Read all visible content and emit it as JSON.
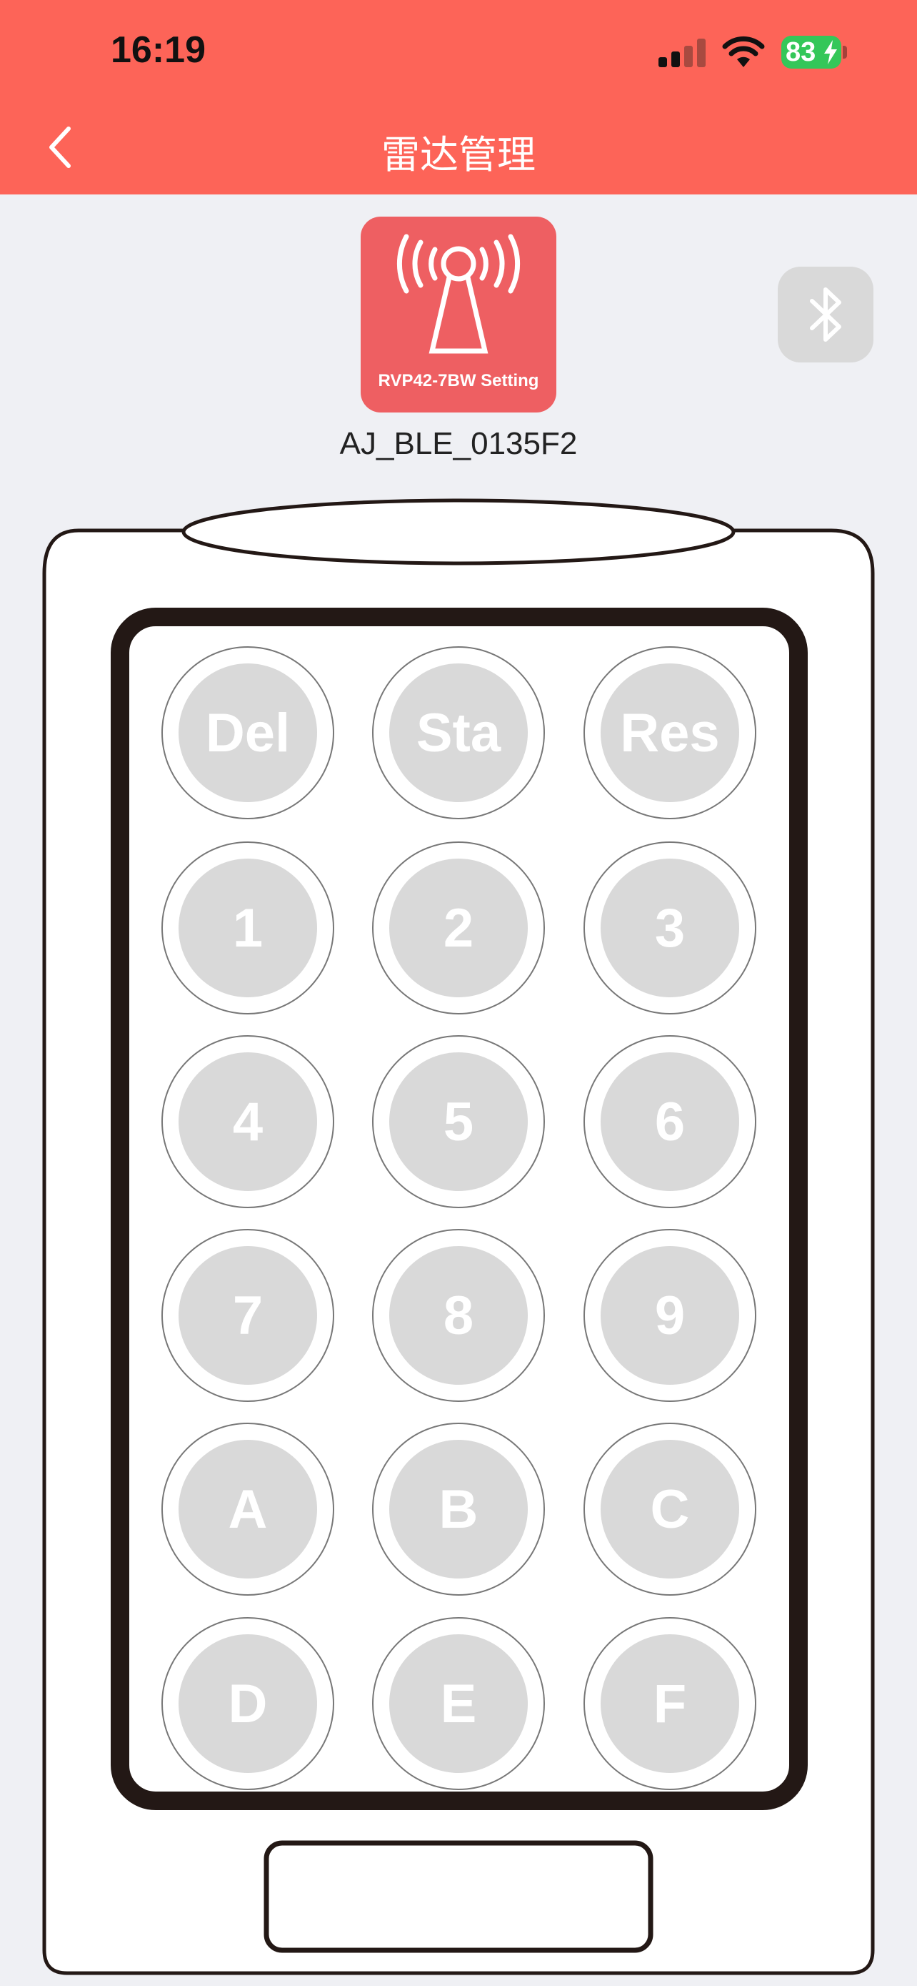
{
  "status_bar": {
    "time": "16:19",
    "battery": "83"
  },
  "nav": {
    "title": "雷达管理"
  },
  "device": {
    "tile_label": "RVP42-7BW Setting",
    "name": "AJ_BLE_0135F2"
  },
  "keypad": {
    "keys": [
      "Del",
      "Sta",
      "Res",
      "1",
      "2",
      "3",
      "4",
      "5",
      "6",
      "7",
      "8",
      "9",
      "A",
      "B",
      "C",
      "D",
      "E",
      "F"
    ]
  },
  "colors": {
    "header": "#fd6458",
    "tile": "#ee5f62",
    "key": "#d9d9d9",
    "background": "#eff0f4"
  },
  "icons": [
    "back-icon",
    "signal-icon",
    "wifi-icon",
    "battery-icon",
    "radar-antenna-icon",
    "bluetooth-icon"
  ]
}
